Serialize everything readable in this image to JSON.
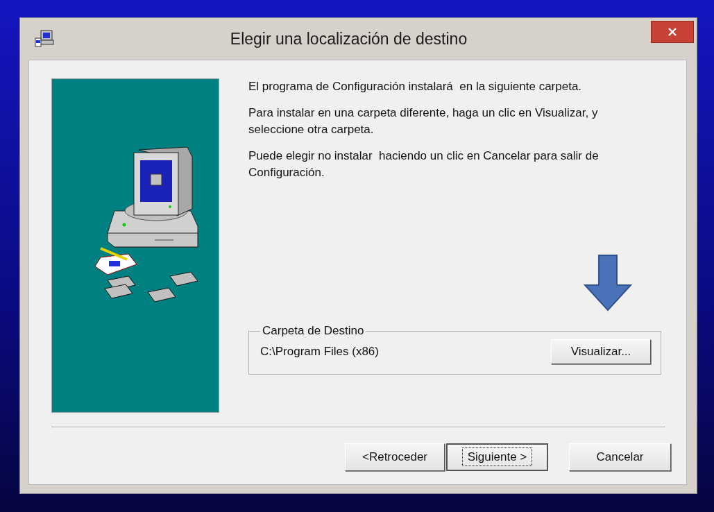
{
  "window": {
    "title": "Elegir una localización de destino"
  },
  "paragraphs": [
    "El programa de Configuración instalará  en la siguiente carpeta.",
    "Para instalar en una carpeta diferente, haga un clic en Visualizar, y seleccione otra carpeta.",
    "Puede elegir no instalar  haciendo un clic en Cancelar para salir de Configuración."
  ],
  "destination": {
    "legend": "Carpeta de Destino",
    "path": "C:\\Program Files (x86)",
    "browse_button": "Visualizar..."
  },
  "buttons": [
    {
      "label": "<Retroceder",
      "focused": false
    },
    {
      "label": "Siguiente >",
      "focused": true
    },
    {
      "label": "Cancelar",
      "focused": false
    }
  ]
}
